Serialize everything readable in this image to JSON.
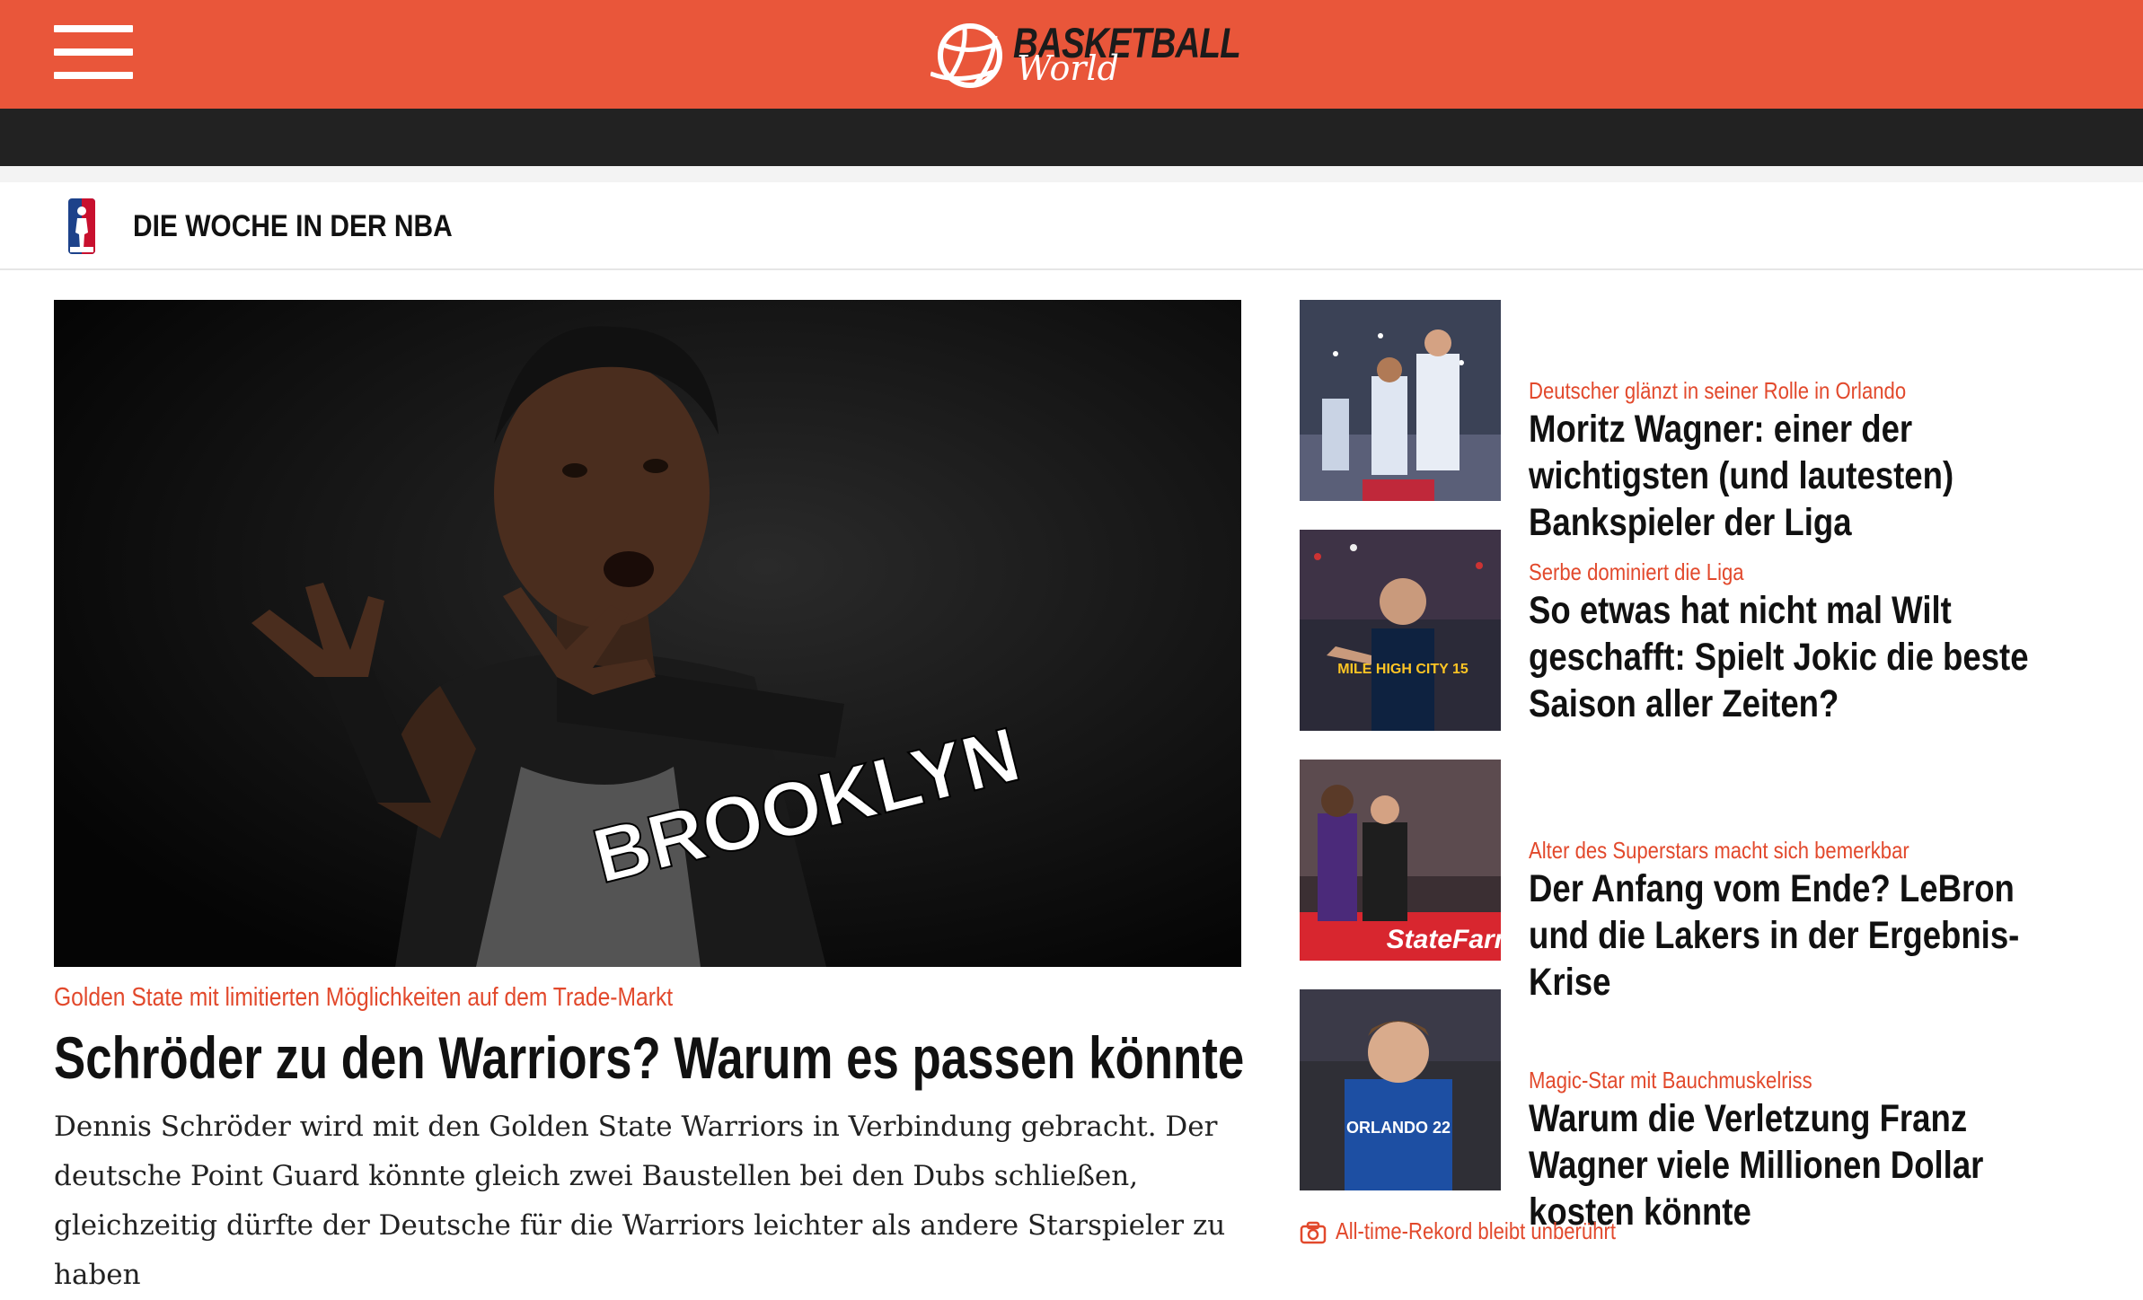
{
  "header": {
    "menu_icon": "hamburger-menu-icon",
    "logo": {
      "word1": "BASKETBALL",
      "word2": "World",
      "icon": "basketball-icon"
    },
    "brand_color": "#e9563a"
  },
  "section": {
    "icon": "nba-logo-icon",
    "title": "DIE WOCHE IN DER NBA"
  },
  "hero": {
    "image": "player-photo-brooklyn",
    "jersey_text": "BROOKLYN",
    "kicker": "Golden State mit limitierten Möglichkeiten auf dem Trade-Markt",
    "title": "Schröder zu den Warriors? Warum es passen könnte",
    "lead": "Dennis Schröder wird mit den Golden State Warriors in Verbindung gebracht. Der deutsche Point Guard könnte gleich zwei Baustellen bei den Dubs schließen, gleichzeitig dürfte der Deutsche für die Warriors leichter als andere Starspieler zu haben"
  },
  "side_articles": [
    {
      "kicker": "Deutscher glänzt in seiner Rolle in Orlando",
      "title": "Moritz Wagner: einer der wichtigsten (und lautesten) Bankspieler der Liga"
    },
    {
      "kicker": "Serbe dominiert die Liga",
      "title": "So etwas hat nicht mal Wilt geschafft: Spielt Jokic die beste Saison aller Zeiten?",
      "jersey": "MILE HIGH CITY 15"
    },
    {
      "kicker": "Alter des Superstars macht sich bemerkbar",
      "title": "Der Anfang vom Ende? LeBron und die Lakers in der Ergebnis-Krise",
      "ad_text": "StateFarm"
    },
    {
      "kicker": "Magic-Star mit Bauchmuskelriss",
      "title": "Warum die Verletzung Franz Wagner viele Millionen Dollar kosten könnte",
      "jersey": "ORLANDO 22"
    }
  ],
  "next_item": {
    "icon": "camera-icon",
    "kicker": "All-time-Rekord bleibt unberührt"
  }
}
